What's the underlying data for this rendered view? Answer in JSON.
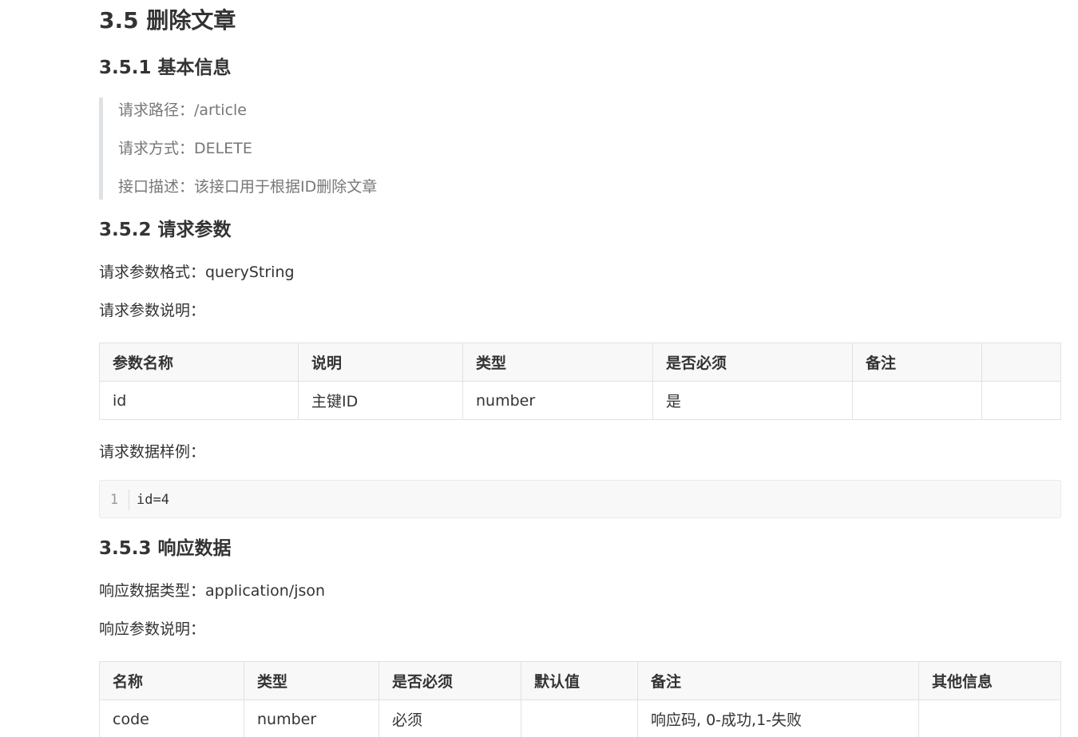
{
  "section": {
    "title": "3.5 删除文章"
  },
  "basic_info": {
    "heading": "3.5.1 基本信息",
    "path": "请求路径：/article",
    "method": "请求方式：DELETE",
    "description": "接口描述：该接口用于根据ID删除文章"
  },
  "request": {
    "heading": "3.5.2 请求参数",
    "format": "请求参数格式：queryString",
    "desc_label": "请求参数说明：",
    "table": {
      "headers": [
        "参数名称",
        "说明",
        "类型",
        "是否必须",
        "备注",
        ""
      ],
      "rows": [
        [
          "id",
          "主键ID",
          "number",
          "是",
          "",
          ""
        ]
      ]
    },
    "sample_label": "请求数据样例：",
    "code": {
      "line_number": "1",
      "content": "id=4"
    }
  },
  "response": {
    "heading": "3.5.3 响应数据",
    "type": "响应数据类型：application/json",
    "desc_label": "响应参数说明：",
    "table": {
      "headers": [
        "名称",
        "类型",
        "是否必须",
        "默认值",
        "备注",
        "其他信息"
      ],
      "rows": [
        [
          "code",
          "number",
          "必须",
          "",
          "响应码, 0-成功,1-失败",
          ""
        ]
      ]
    }
  }
}
